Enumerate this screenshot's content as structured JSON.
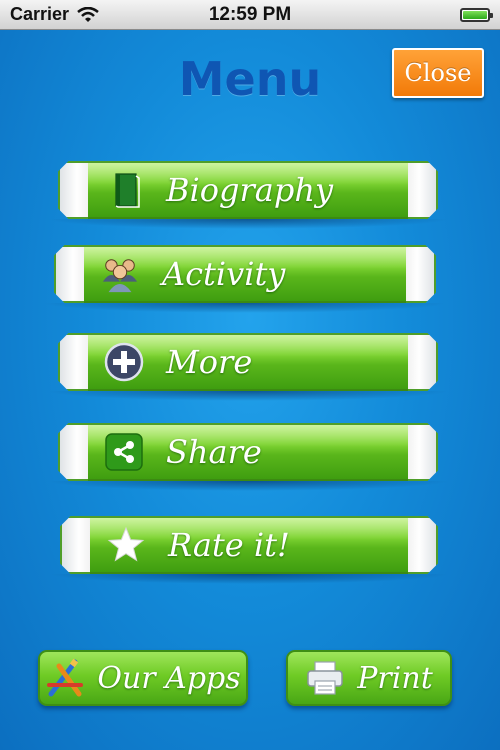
{
  "status_bar": {
    "carrier": "Carrier",
    "time": "12:59 PM"
  },
  "screen": {
    "title": "Menu",
    "close_label": "Close"
  },
  "menu_items": [
    {
      "label": "Biography",
      "icon": "book-icon"
    },
    {
      "label": "Activity",
      "icon": "people-icon"
    },
    {
      "label": "More",
      "icon": "plus-circle-icon"
    },
    {
      "label": "Share",
      "icon": "share-icon"
    },
    {
      "label": "Rate it!",
      "icon": "star-icon"
    }
  ],
  "bottom": {
    "our_apps_label": "Our Apps",
    "our_apps_icon": "app-store-icon",
    "print_label": "Print",
    "print_icon": "printer-icon"
  },
  "colors": {
    "background": "#1389d8",
    "title": "#0f56b3",
    "close": "#f58a18",
    "button_green": "#6cc52a"
  }
}
